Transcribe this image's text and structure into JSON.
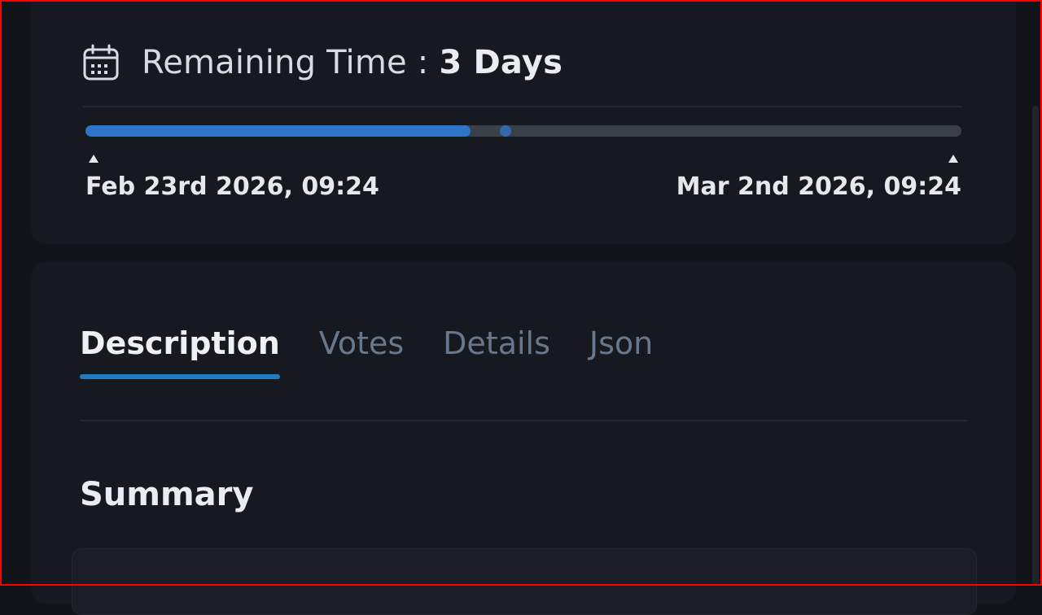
{
  "remaining": {
    "label": "Remaining Time : ",
    "value": "3 Days",
    "icon": "calendar-icon"
  },
  "progress": {
    "fraction": 0.44,
    "marker_fraction": 0.48,
    "start_date": "Feb 23rd 2026, 09:24",
    "end_date": "Mar 2nd 2026, 09:24"
  },
  "tabs": [
    {
      "label": "Description",
      "active": true
    },
    {
      "label": "Votes",
      "active": false
    },
    {
      "label": "Details",
      "active": false
    },
    {
      "label": "Json",
      "active": false
    }
  ],
  "summary": {
    "title": "Summary"
  },
  "colors": {
    "accent": "#2e74c8",
    "tab_underline": "#1f7cc0",
    "background": "#121419",
    "card": "#16191f"
  }
}
